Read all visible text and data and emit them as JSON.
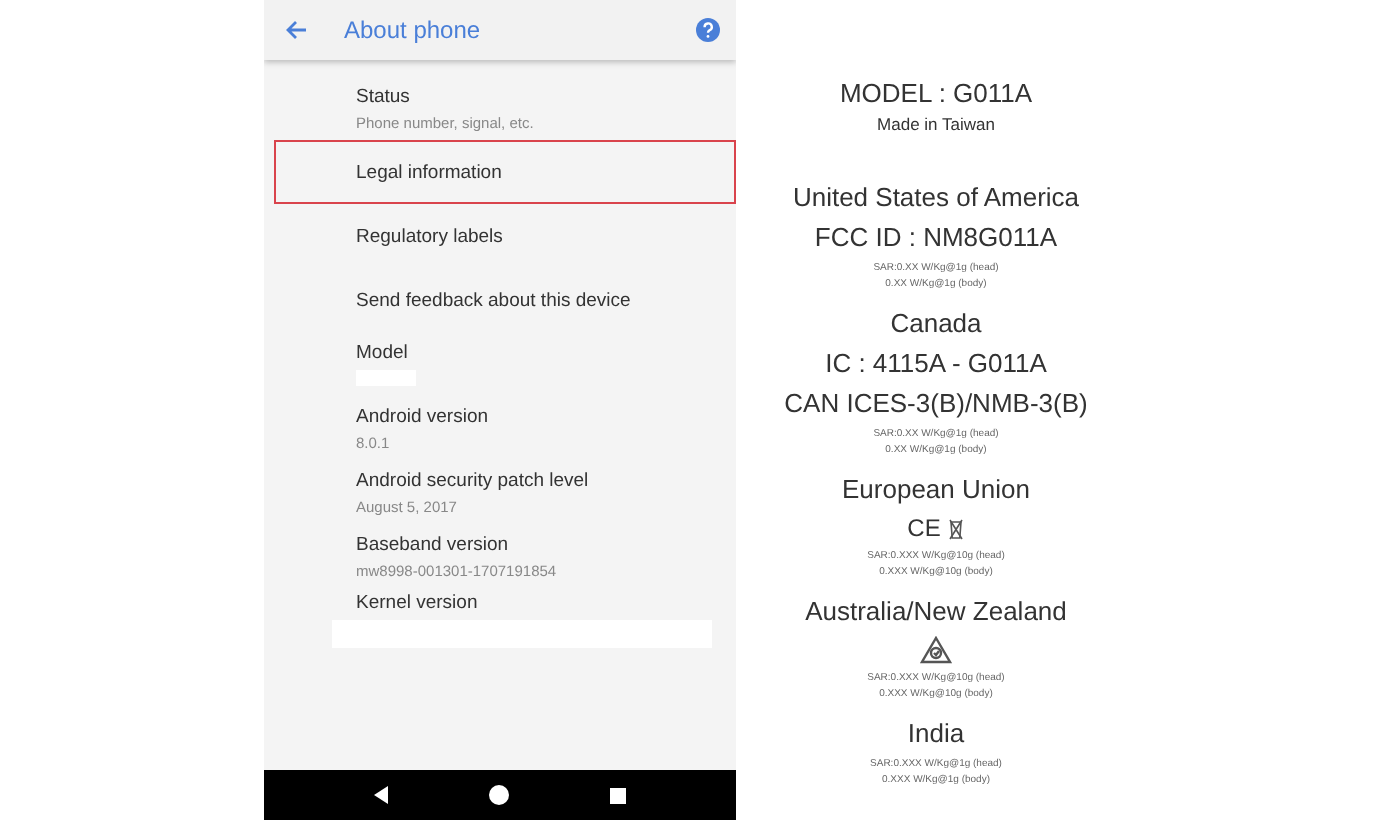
{
  "header": {
    "title": "About phone"
  },
  "settings": [
    {
      "title": "Status",
      "subtitle": "Phone number, signal, etc.",
      "highlighted": false,
      "value_hidden": false
    },
    {
      "title": "Legal information",
      "highlighted": true,
      "value_hidden": false
    },
    {
      "title": "Regulatory labels",
      "highlighted": false,
      "value_hidden": false
    },
    {
      "title": "Send feedback about this device",
      "highlighted": false,
      "value_hidden": false
    },
    {
      "title": "Model",
      "highlighted": false,
      "value_hidden": true
    },
    {
      "title": "Android version",
      "subtitle": "8.0.1",
      "highlighted": false,
      "value_hidden": false
    },
    {
      "title": "Android security patch level",
      "subtitle": "August 5, 2017",
      "highlighted": false,
      "value_hidden": false
    },
    {
      "title": "Baseband version",
      "subtitle": "mw8998-001301-1707191854",
      "highlighted": false,
      "value_hidden": false
    },
    {
      "title": "Kernel version",
      "highlighted": false,
      "value_hidden": true
    }
  ],
  "label": {
    "model": "MODEL : G011A",
    "origin": "Made in Taiwan",
    "regions": [
      {
        "name": "United States of America",
        "ids": [
          "FCC ID : NM8G011A"
        ],
        "sar": [
          "SAR:0.XX W/Kg@1g (head)",
          "0.XX W/Kg@1g (body)"
        ]
      },
      {
        "name": "Canada",
        "ids": [
          "IC : 4115A - G011A",
          "CAN ICES-3(B)/NMB-3(B)"
        ],
        "sar": [
          "SAR:0.XX W/Kg@1g (head)",
          "0.XX W/Kg@1g (body)"
        ]
      },
      {
        "name": "European Union",
        "marks": [
          {
            "kind": "ce",
            "text": "CE"
          },
          {
            "kind": "weee"
          }
        ],
        "sar": [
          "SAR:0.XXX W/Kg@10g (head)",
          "0.XXX W/Kg@10g (body)"
        ]
      },
      {
        "name": "Australia/New Zealand",
        "marks": [
          {
            "kind": "rcm"
          }
        ],
        "sar": [
          "SAR:0.XXX W/Kg@10g (head)",
          "0.XXX W/Kg@10g (body)"
        ]
      },
      {
        "name": "India",
        "sar": [
          "SAR:0.XXX W/Kg@1g (head)",
          "0.XXX W/Kg@1g (body)"
        ]
      }
    ]
  }
}
